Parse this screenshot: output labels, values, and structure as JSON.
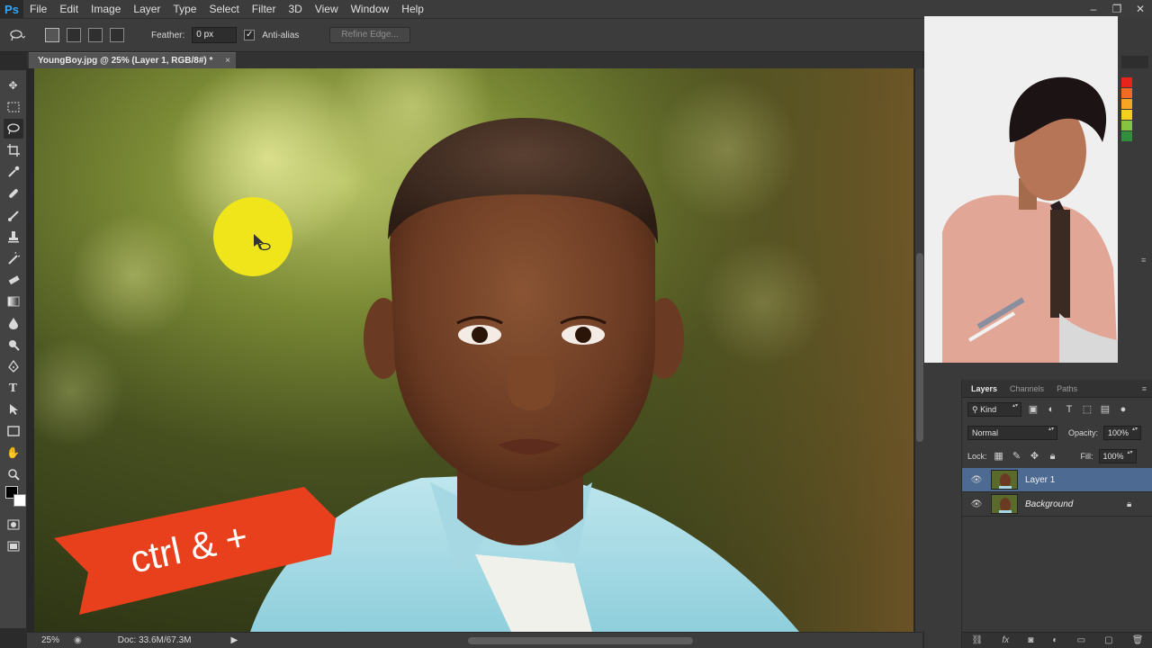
{
  "app": {
    "logo": "Ps"
  },
  "menu": [
    "File",
    "Edit",
    "Image",
    "Layer",
    "Type",
    "Select",
    "Filter",
    "3D",
    "View",
    "Window",
    "Help"
  ],
  "window_controls": [
    "–",
    "❐",
    "✕"
  ],
  "options": {
    "feather_label": "Feather:",
    "feather_value": "0 px",
    "antialias_label": "Anti-alias",
    "antialias_checked": "✓",
    "refine_edge": "Refine Edge..."
  },
  "document": {
    "tab_title": "YoungBoy.jpg @ 25% (Layer 1, RGB/8#) *",
    "close": "×"
  },
  "overlay": {
    "banner_text": "ctrl & +",
    "banner_color": "#e8401c",
    "cursor_highlight_color": "#f0e51a"
  },
  "status": {
    "zoom": "25%",
    "doc_size": "Doc: 33.6M/67.3M"
  },
  "layers_panel": {
    "tabs": [
      "Layers",
      "Channels",
      "Paths"
    ],
    "filter_kind": "Kind",
    "blend_mode": "Normal",
    "opacity_label": "Opacity:",
    "opacity_value": "100%",
    "lock_label": "Lock:",
    "fill_label": "Fill:",
    "fill_value": "100%",
    "layers": [
      {
        "name": "Layer 1",
        "selected": true
      },
      {
        "name": "Background",
        "locked": true
      }
    ]
  },
  "colors": {
    "selection_blue": "#4d6a93",
    "panel_bg": "#3a3a3a",
    "accent": "#31a8ff"
  }
}
